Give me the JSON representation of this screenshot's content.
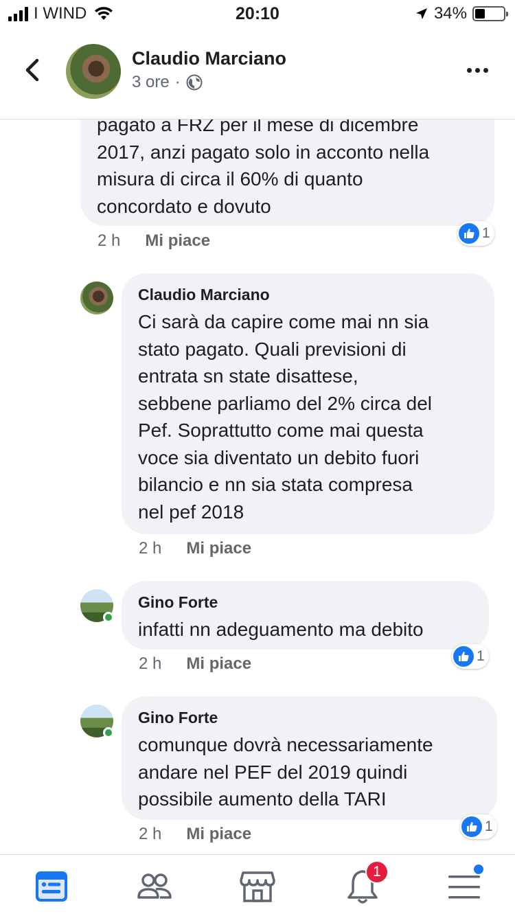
{
  "status_bar": {
    "carrier": "I WIND",
    "time": "20:10",
    "battery": "34%",
    "battery_level": 0.34
  },
  "header": {
    "name": "Claudio Marciano",
    "time_ago": "3 ore",
    "separator": "·"
  },
  "comments": [
    {
      "author": "",
      "text_lines": [
        "pagato a FRZ  per il mese di dicembre",
        "2017, anzi pagato solo in acconto nella",
        "misura di circa il 60% di quanto",
        "concordato e dovuto"
      ],
      "time": "2 h",
      "like_label": "Mi piace",
      "reactions": "1"
    },
    {
      "author": "Claudio Marciano",
      "text_lines": [
        "Ci sarà da capire come mai nn sia",
        "stato pagato. Quali previsioni di",
        "entrata sn state disattese,",
        "sebbene parliamo del 2% circa del",
        "Pef. Soprattutto come mai questa",
        "voce sia diventato un debito fuori",
        "bilancio e nn sia stata compresa",
        "nel pef 2018"
      ],
      "time": "2 h",
      "like_label": "Mi piace",
      "reactions": ""
    },
    {
      "author": "Gino Forte",
      "text_lines": [
        "infatti nn adeguamento ma debito"
      ],
      "time": "2 h",
      "like_label": "Mi piace",
      "reactions": "1"
    },
    {
      "author": "Gino Forte",
      "text_lines": [
        "comunque dovrà necessariamente",
        "andare nel PEF del 2019 quindi",
        "possibile aumento della TARI"
      ],
      "time": "2 h",
      "like_label": "Mi piace",
      "reactions": "1"
    }
  ],
  "tab_bar": {
    "items": [
      {
        "name": "news-feed",
        "icon": "news-feed-icon",
        "active": true
      },
      {
        "name": "friends",
        "icon": "friends-icon",
        "active": false
      },
      {
        "name": "marketplace",
        "icon": "marketplace-icon",
        "active": false
      },
      {
        "name": "notifications",
        "icon": "bell-icon",
        "active": false,
        "badge": "1"
      },
      {
        "name": "menu",
        "icon": "menu-icon",
        "active": false
      }
    ]
  },
  "colors": {
    "accent": "#1877f2",
    "bubble": "#f0f2f5",
    "badge": "#e41e3f",
    "online": "#31a24c"
  }
}
